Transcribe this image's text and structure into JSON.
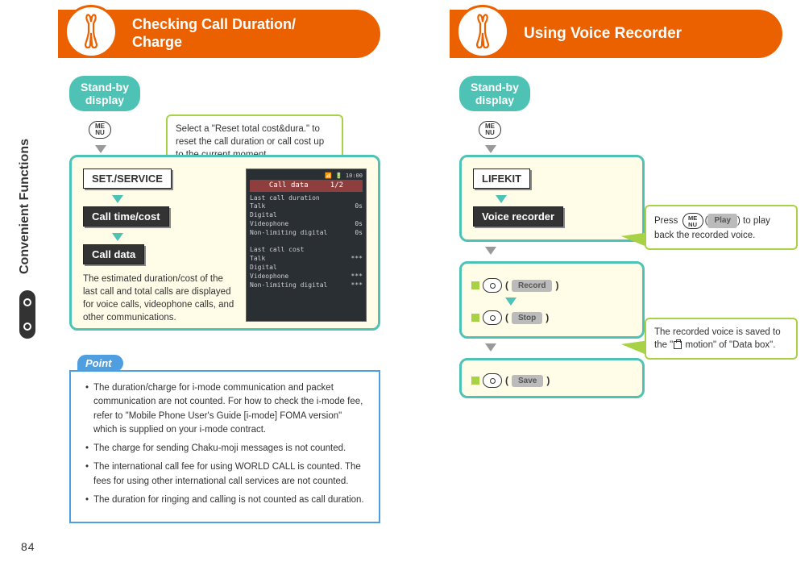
{
  "page_number": "84",
  "side_tab": "Convenient Functions",
  "col_left": {
    "title": "Checking Call Duration/\nCharge",
    "standby": "Stand-by\ndisplay",
    "menu_key": "ME\nNU",
    "callout_reset": "Select a \"Reset total cost&dura.\" to reset the call duration or call cost up to the current moment.",
    "nav": {
      "item1": "SET./SERVICE",
      "item2": "Call time/cost",
      "item3": "Call data"
    },
    "card_desc": "The estimated duration/cost of the last call and total calls are displayed for voice calls, videophone calls, and other communications.",
    "screen": {
      "title_bar": "Call data",
      "page_ind": "1/2",
      "line1": "Last call duration",
      "line2": "Talk",
      "val2": "0s",
      "line3": "Digital",
      "line4": "  Videophone",
      "val4": "0s",
      "line5": "  Non-limiting digital",
      "val5": "0s",
      "blank": "",
      "line6": "Last call cost",
      "line7": "Talk",
      "val7": "***",
      "line8": "Digital",
      "line9": "  Videophone",
      "val9": "***",
      "line10": "  Non-limiting digital",
      "val10": "***"
    },
    "point_label": "Point",
    "point_items": {
      "p1": "The duration/charge for i-mode communication and packet communication are not counted. For how to check the i-mode fee, refer to \"Mobile Phone User's Guide [i-mode] FOMA version\" which is supplied on your i-mode contract.",
      "p2": "The charge for sending Chaku-moji messages is not counted.",
      "p3": "The international call fee for using WORLD CALL is counted. The fees for using other international call services are not counted.",
      "p4": "The duration for ringing and calling is not counted as call duration."
    }
  },
  "col_right": {
    "title": "Using Voice Recorder",
    "standby": "Stand-by\ndisplay",
    "menu_key": "ME\nNU",
    "nav": {
      "item1": "LIFEKIT",
      "item2": "Voice recorder"
    },
    "keys": {
      "record": "Record",
      "stop": "Stop",
      "save": "Save",
      "play": "Play"
    },
    "callout_play_pre": "Press ",
    "callout_play_mid": "(",
    "callout_play_post": ") to play back the recorded voice.",
    "callout_save_pre": "The recorded voice is saved to the \"",
    "callout_save_post": " motion\" of \"Data box\"."
  }
}
